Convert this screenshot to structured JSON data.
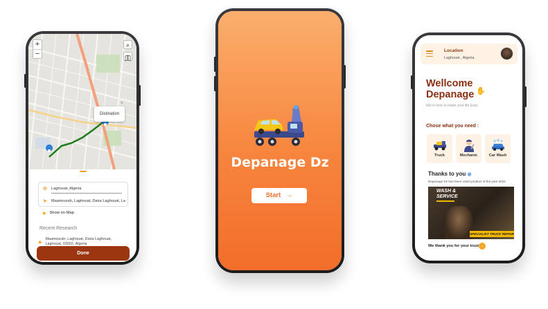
{
  "map_screen": {
    "zoom_in": "+",
    "zoom_out": "−",
    "popup_label": "Distination",
    "from_location": "Laghouat, Algeria",
    "to_location": "Maamourah, Laghouat, Daira Laghouat, La",
    "show_on_map": "Show on Map",
    "recent_title": "Recent Research",
    "recent_item_line1": "Maamourah, Laghouat, Daira Laghouat,",
    "recent_item_line2": "Laghouat, 03002, Algeria",
    "done_label": "Done"
  },
  "splash_screen": {
    "title": "Depanage Dz",
    "start_label": "Start",
    "arrow": "→"
  },
  "home_screen": {
    "location_label": "Location",
    "location_value": "Laghouat , Algeria",
    "welcome_line1": "Wellcome",
    "welcome_line2": "Depanage",
    "subtitle": "We're here to make your life Easy",
    "choose_label": "Chose what you need :",
    "services": [
      {
        "label": "Truck"
      },
      {
        "label": "Mechanic"
      },
      {
        "label": "Car Wash"
      }
    ],
    "thanks_title": "Thanks to you",
    "thanks_sub": "Depanage Dz has been voted product of the year 2024",
    "banner_line1": "WASH &",
    "banner_line2": "SERVICE",
    "banner_tag": "SPECIALIST TRUCK REPAIR",
    "trust_text": "We thank you for your trust",
    "trust_arrow": "→"
  },
  "colors": {
    "brand_orange": "#f7853d",
    "brand_dark": "#8a3010",
    "accent": "#f5a623"
  }
}
